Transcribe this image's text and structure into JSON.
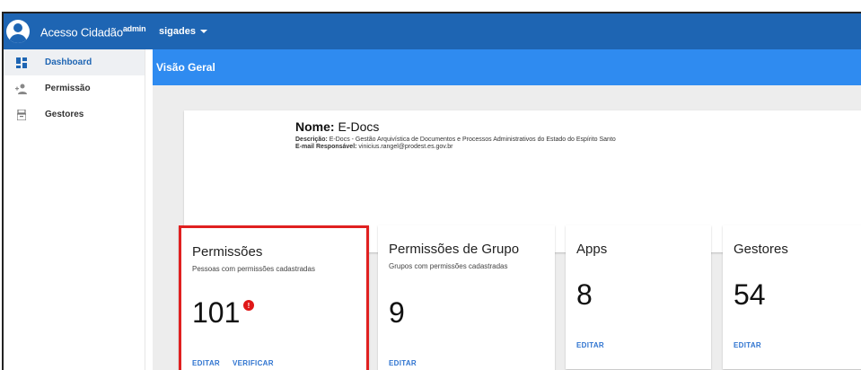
{
  "header": {
    "brand_title": "Acesso Cidadão",
    "brand_suffix": "admin",
    "system_menu": "sigades"
  },
  "sidebar": {
    "items": [
      {
        "label": "Dashboard",
        "icon": "dashboard-icon",
        "active": true
      },
      {
        "label": "Permissão",
        "icon": "add-person-icon",
        "active": false
      },
      {
        "label": "Gestores",
        "icon": "manager-icon",
        "active": false
      }
    ]
  },
  "main": {
    "title": "Visão Geral",
    "info": {
      "name_label": "Nome:",
      "name_value": "E-Docs",
      "desc_label": "Descrição:",
      "desc_value": "E-Docs - Gestão Arquivística de Documentos e Processos Administrativos do Estado do Espírito Santo",
      "email_label": "E-mail Responsável:",
      "email_value": "vinicius.rangel@prodest.es.gov.br"
    },
    "cards": [
      {
        "title": "Permissões",
        "subtitle": "Pessoas com permissões cadastradas",
        "value": "101",
        "badge": "!",
        "actions": [
          "EDITAR",
          "VERIFICAR"
        ]
      },
      {
        "title": "Permissões de Grupo",
        "subtitle": "Grupos com permissões cadastradas",
        "value": "9",
        "actions": [
          "EDITAR"
        ]
      },
      {
        "title": "Apps",
        "subtitle": "",
        "value": "8",
        "actions": [
          "EDITAR"
        ]
      },
      {
        "title": "Gestores",
        "subtitle": "",
        "value": "54",
        "actions": [
          "EDITAR"
        ]
      }
    ]
  },
  "colors": {
    "topbar": "#1e65b3",
    "header": "#2f8bf0",
    "highlight": "#e02020",
    "action": "#2f74d0"
  }
}
